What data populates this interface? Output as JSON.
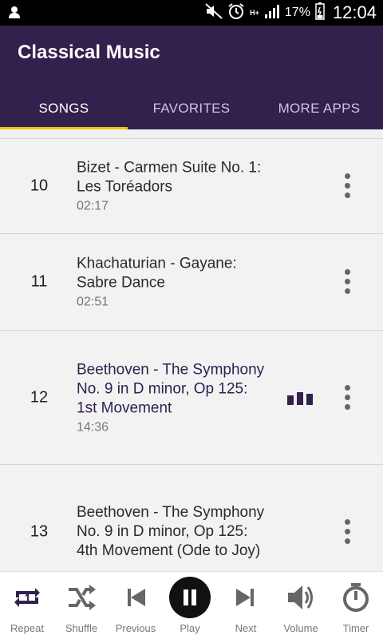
{
  "status_bar": {
    "battery_percent": "17%",
    "clock": "12:04",
    "network": "H+"
  },
  "app": {
    "title": "Classical Music",
    "accent_color": "#32204d",
    "indicator_color": "#f1c40f"
  },
  "tabs": [
    {
      "label": "SONGS",
      "active": true
    },
    {
      "label": "FAVORITES",
      "active": false
    },
    {
      "label": "MORE APPS",
      "active": false
    }
  ],
  "songs": [
    {
      "number": "10",
      "title": "Bizet - Carmen Suite No. 1: Les Toréadors",
      "duration": "02:17",
      "playing": false
    },
    {
      "number": "11",
      "title": "Khachaturian - Gayane: Sabre Dance",
      "duration": "02:51",
      "playing": false
    },
    {
      "number": "12",
      "title": "Beethoven - The Symphony No. 9 in D minor, Op 125: 1st Movement",
      "duration": "14:36",
      "playing": true
    },
    {
      "number": "13",
      "title": "Beethoven - The Symphony No. 9 in D minor, Op 125: 4th Movement (Ode to Joy)",
      "duration": "",
      "playing": false
    }
  ],
  "player": {
    "repeat": "Repeat",
    "shuffle": "Shuffle",
    "previous": "Previous",
    "play": "Play",
    "next": "Next",
    "volume": "Volume",
    "timer": "Timer"
  }
}
